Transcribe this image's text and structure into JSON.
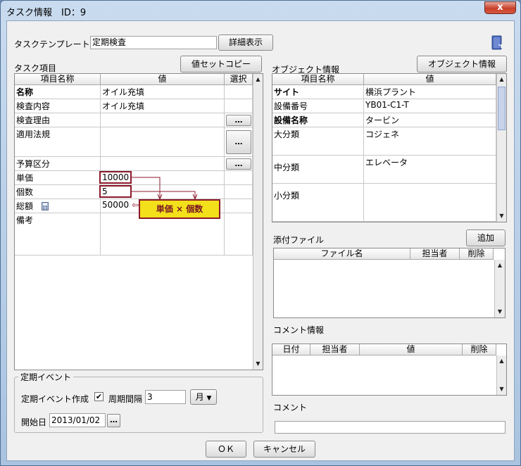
{
  "window": {
    "title": "タスク情報　ID：9",
    "close_glyph": "x"
  },
  "template": {
    "label": "タスクテンプレート",
    "value": "定期検査",
    "detail_button": "詳細表示"
  },
  "task": {
    "section_label": "タスク項目",
    "copy_button": "値セットコピー",
    "headers": [
      "項目名称",
      "値",
      "選択"
    ],
    "rows": [
      {
        "name": "名称",
        "value": "オイル充填"
      },
      {
        "name": "検査内容",
        "value": "オイル充填"
      },
      {
        "name": "検査理由",
        "value": ""
      },
      {
        "name": "適用法規",
        "value": ""
      },
      {
        "name": "予算区分",
        "value": ""
      },
      {
        "name": "単価",
        "value": "10000"
      },
      {
        "name": "個数",
        "value": "5"
      },
      {
        "name": "総額",
        "value": "50000"
      },
      {
        "name": "備考",
        "value": ""
      }
    ],
    "select_glyph": "…",
    "formula_tip": "単価 × 個数",
    "arrow_glyph": "⇦"
  },
  "object": {
    "section_label": "オブジェクト情報",
    "button": "オブジェクト情報",
    "headers": [
      "項目名称",
      "値"
    ],
    "rows": [
      {
        "name": "サイト",
        "value": "横浜プラント"
      },
      {
        "name": "設備番号",
        "value": "YB01-C1-T"
      },
      {
        "name": "設備名称",
        "value": "タービン"
      },
      {
        "name": "大分類",
        "value": "コジェネ"
      },
      {
        "name": "中分類",
        "value": "エレベータ"
      },
      {
        "name": "小分類",
        "value": ""
      }
    ]
  },
  "attach": {
    "label": "添付ファイル",
    "add_button": "追加",
    "headers": [
      "ファイル名",
      "担当者",
      "削除"
    ]
  },
  "comments": {
    "label": "コメント情報",
    "headers": [
      "日付",
      "担当者",
      "値",
      "削除"
    ],
    "comment_label": "コメント",
    "comment_value": ""
  },
  "event": {
    "legend": "定期イベント",
    "create_label": "定期イベント作成",
    "checked_glyph": "✔",
    "interval_label": "周期間隔",
    "interval_value": "3",
    "unit_value": "月",
    "start_label": "開始日",
    "start_value": "2013/01/02"
  },
  "footer": {
    "ok": "ＯＫ",
    "cancel": "キャンセル"
  },
  "colors": {
    "highlight": "#8b1a2b",
    "tip_bg": "#f3e01a",
    "accent_blue": "#4a67b8"
  }
}
